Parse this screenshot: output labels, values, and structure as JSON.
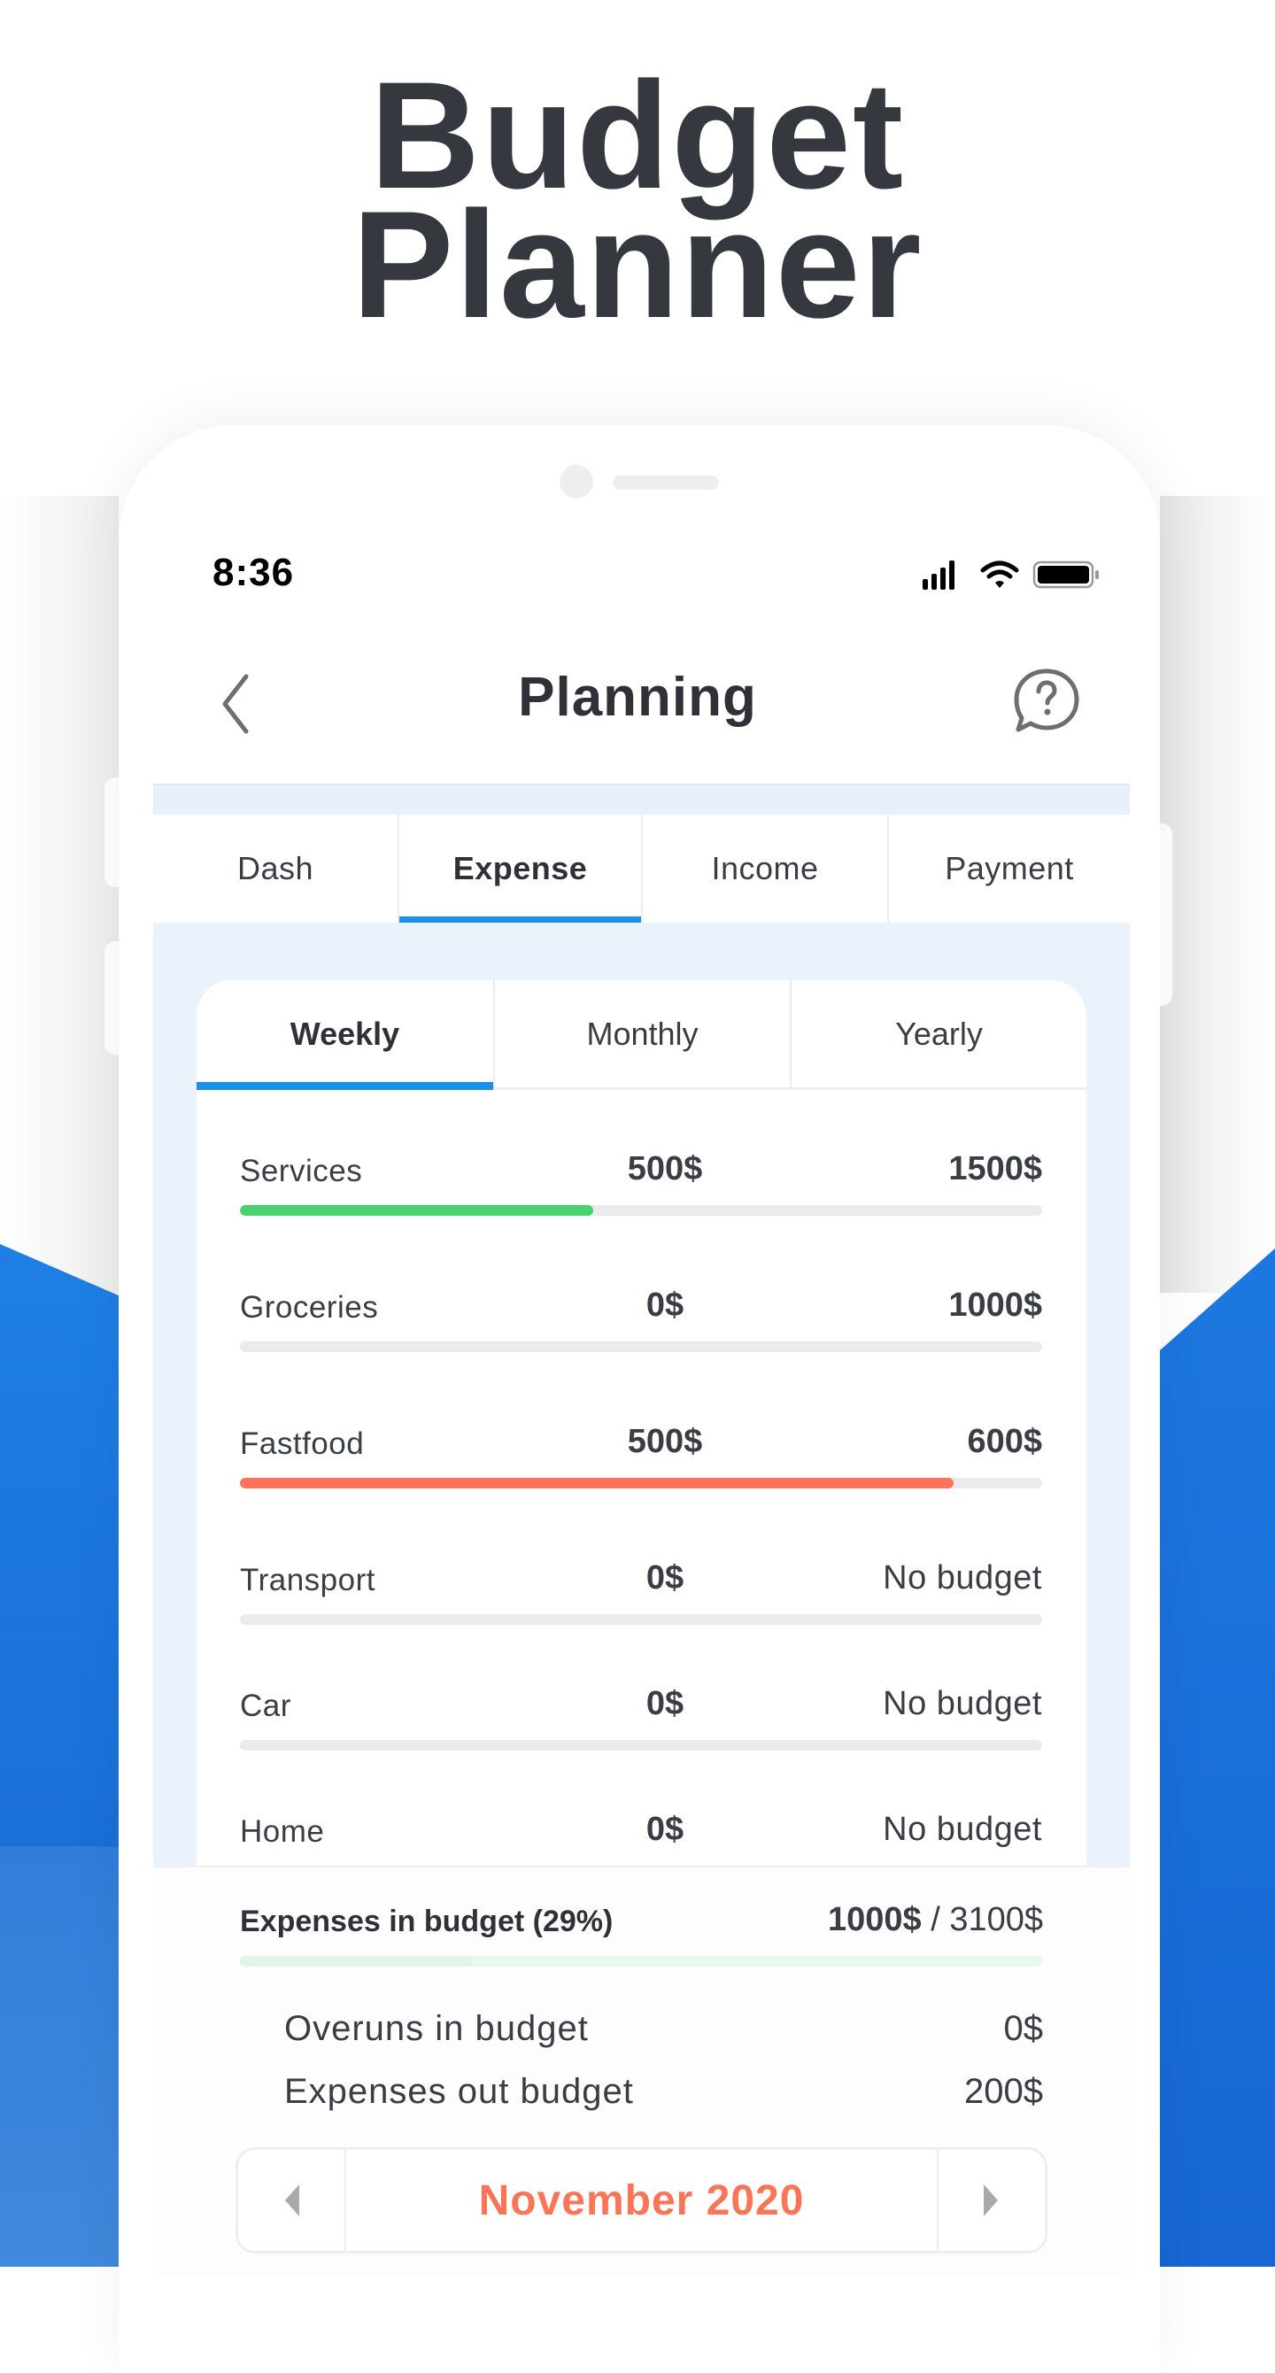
{
  "headline": {
    "line1": "Budget",
    "line2": "Planner"
  },
  "status_bar": {
    "time": "8:36",
    "icons": [
      "cellular-signal-icon",
      "wifi-icon",
      "battery-icon"
    ]
  },
  "nav": {
    "title": "Planning",
    "back_icon": "chevron-left-icon",
    "help_icon": "help-chat-bubble-icon"
  },
  "tabs": [
    {
      "label": "Dash",
      "active": false
    },
    {
      "label": "Expense",
      "active": true
    },
    {
      "label": "Income",
      "active": false
    },
    {
      "label": "Payment",
      "active": false
    }
  ],
  "period_tabs": [
    {
      "label": "Weekly",
      "active": true
    },
    {
      "label": "Monthly",
      "active": false
    },
    {
      "label": "Yearly",
      "active": false
    }
  ],
  "categories": [
    {
      "name": "Services",
      "spent": "500$",
      "budget": "1500$",
      "progress": 0.44,
      "color": "#45d46b"
    },
    {
      "name": "Groceries",
      "spent": "0$",
      "budget": "1000$",
      "progress": 0,
      "color": "#45d46b"
    },
    {
      "name": "Fastfood",
      "spent": "500$",
      "budget": "600$",
      "progress": 0.89,
      "color": "#fb7358"
    },
    {
      "name": "Transport",
      "spent": "0$",
      "budget": "No budget",
      "progress": 0,
      "color": "#ebebeb"
    },
    {
      "name": "Car",
      "spent": "0$",
      "budget": "No budget",
      "progress": 0,
      "color": "#ebebeb"
    },
    {
      "name": "Home",
      "spent": "0$",
      "budget": "No budget",
      "progress": 0,
      "color": "#ebebeb"
    }
  ],
  "summary": {
    "label": "Expenses in budget (29%)",
    "spent": "1000$",
    "separator": " / ",
    "total": "3100$",
    "progress": 0.29,
    "overruns_label": "Overuns in budget",
    "overruns_value": "0$",
    "out_budget_label": "Expenses out budget",
    "out_budget_value": "200$"
  },
  "month_picker": {
    "label": "November 2020",
    "prev_icon": "triangle-left-icon",
    "next_icon": "triangle-right-icon"
  },
  "colors": {
    "accent": "#1a90e8",
    "good": "#45d46b",
    "over": "#fb7358",
    "month": "#fa7457",
    "text": "#2f3038"
  }
}
